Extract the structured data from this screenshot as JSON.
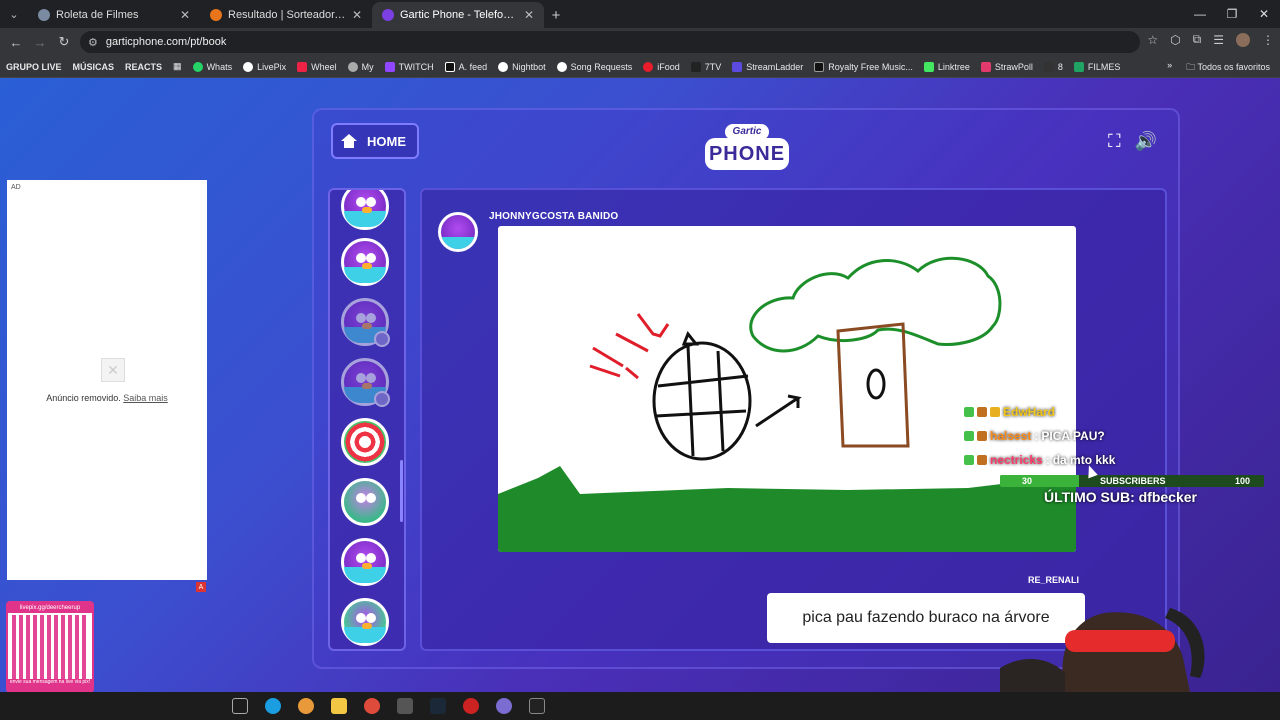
{
  "browser": {
    "tabs": [
      {
        "title": "Roleta de Filmes",
        "active": false
      },
      {
        "title": "Resultado | Sorteador.com.br ·",
        "active": false
      },
      {
        "title": "Gartic Phone - Telefone sem fio",
        "active": true
      }
    ],
    "url": "garticphone.com/pt/book",
    "bookmarks": [
      "GRUPO LIVE",
      "MÚSICAS",
      "REACTS",
      "Whats",
      "LivePix",
      "Wheel",
      "My",
      "TWITCH",
      "A. feed",
      "Nightbot",
      "Song Requests",
      "iFood",
      "7TV",
      "StreamLadder",
      "Royalty Free Music...",
      "Linktree",
      "StrawPoll",
      "8",
      "FILMES"
    ],
    "bookmarks_right": "Todos os favoritos"
  },
  "ad": {
    "tag": "AD",
    "removed_text": "Anúncio removido.",
    "learn_more": "Saiba mais",
    "badge": "A"
  },
  "qr": {
    "top": "livepix.gg/deercheerup",
    "bottom": "envie sua mensagem na live via pix!"
  },
  "game": {
    "home_label": "HOME",
    "logo_top": "Gartic",
    "logo_main": "PHONE",
    "player_name": "JHONNYGCOSTA BANIDO",
    "guess_text": "pica pau fazendo buraco na árvore"
  },
  "overlay": {
    "chat": [
      {
        "user": "EdwHard",
        "message": ""
      },
      {
        "user": "halsest",
        "message": "PICA PAU?"
      },
      {
        "user": "nectricks",
        "message": "da mto kkk"
      }
    ],
    "subs_current": "30",
    "subs_label": "SUBSCRIBERS",
    "subs_goal": "100",
    "subs_progress": 0.3,
    "last_sub": "ÚLTIMO SUB: dfbecker",
    "streamer_tag": "RE_RENALI"
  },
  "colors": {
    "page_bg_start": "#2a5fd6",
    "page_bg_end": "#3a2390",
    "grass": "#1f8a2a",
    "tree_leaves": "#1d8f2a",
    "trunk": "#8a4a22",
    "scribble": "#e01e2a"
  }
}
